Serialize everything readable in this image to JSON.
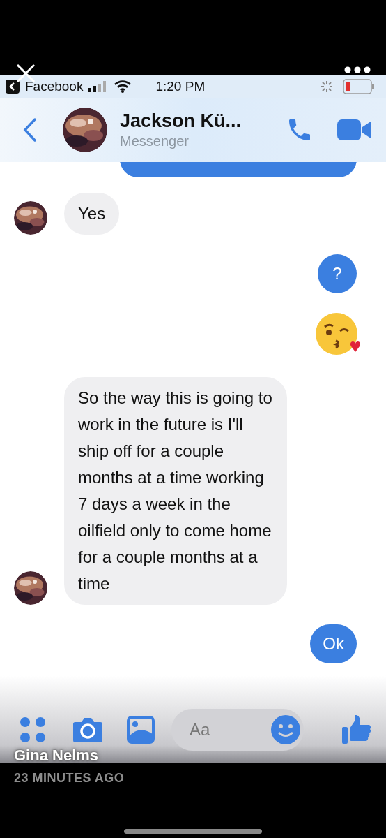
{
  "status_bar": {
    "back_app": "Facebook",
    "time": "1:20 PM"
  },
  "header": {
    "name": "Jackson Kü...",
    "subtitle": "Messenger"
  },
  "messages": [
    {
      "kind": "cut"
    },
    {
      "kind": "incoming",
      "text": "Yes"
    },
    {
      "kind": "outgoing",
      "text": "?"
    },
    {
      "kind": "emoji"
    },
    {
      "kind": "incoming",
      "text": "So the way this is going to work in the future is I'll ship off for a couple months at a time working 7 days a week in the oilfield only to come home for a couple months at a time"
    },
    {
      "kind": "outgoing",
      "text": "Ok"
    }
  ],
  "composer": {
    "placeholder": "Aa"
  },
  "story": {
    "author": "Gina Nelms",
    "time": "23 MINUTES AGO"
  }
}
